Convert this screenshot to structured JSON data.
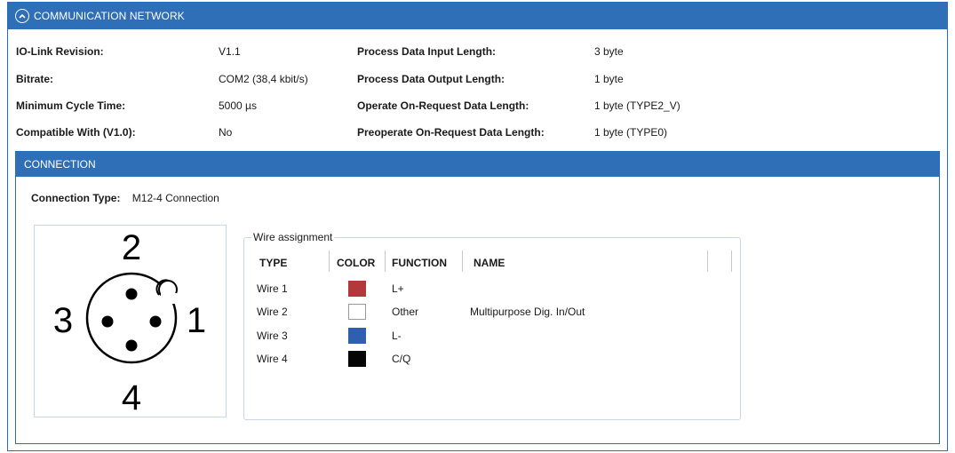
{
  "header": {
    "title": "COMMUNICATION NETWORK",
    "toggle_icon": "chevron-up-circle-icon"
  },
  "info": {
    "rows": [
      {
        "label1": "IO-Link Revision:",
        "value1": "V1.1",
        "label2": "Process Data Input Length:",
        "value2": "3 byte"
      },
      {
        "label1": "Bitrate:",
        "value1": "COM2 (38,4 kbit/s)",
        "label2": "Process Data Output Length:",
        "value2": "1 byte"
      },
      {
        "label1": "Minimum Cycle Time:",
        "value1": "5000 µs",
        "label2": "Operate On-Request Data Length:",
        "value2": "1 byte (TYPE2_V)"
      },
      {
        "label1": "Compatible With (V1.0):",
        "value1": "No",
        "label2": "Preoperate On-Request Data Length:",
        "value2": "1 byte (TYPE0)"
      }
    ]
  },
  "connection": {
    "title": "CONNECTION",
    "type_label": "Connection Type:",
    "type_value": "M12-4 Connection",
    "pin_diagram": {
      "labels": [
        "2",
        "3",
        "1",
        "4"
      ]
    }
  },
  "wire_assignment": {
    "legend": "Wire assignment",
    "columns": [
      "TYPE",
      "COLOR",
      "FUNCTION",
      "NAME"
    ],
    "rows": [
      {
        "type": "Wire 1",
        "color": "#b3373b",
        "function": "L+",
        "name": ""
      },
      {
        "type": "Wire 2",
        "color": "#ffffff",
        "function": "Other",
        "name": "Multipurpose Dig. In/Out"
      },
      {
        "type": "Wire 3",
        "color": "#2f5fae",
        "function": "L-",
        "name": ""
      },
      {
        "type": "Wire 4",
        "color": "#050505",
        "function": "C/Q",
        "name": ""
      }
    ]
  },
  "colors": {
    "accent": "#2f6fb7",
    "border": "#2b6cb8"
  }
}
